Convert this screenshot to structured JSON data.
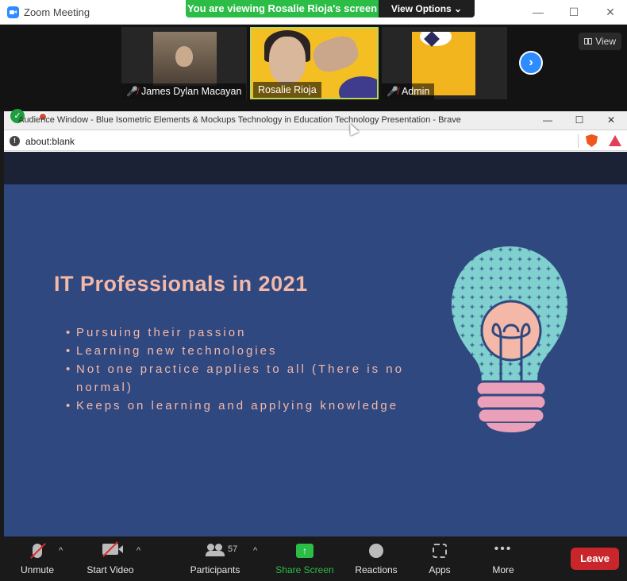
{
  "zoom": {
    "window_title": "Zoom Meeting",
    "share_banner": "You are viewing Rosalie Rioja's screen",
    "view_options": "View Options ⌄",
    "view_button": "View"
  },
  "participants_strip": [
    {
      "name": "James Dylan Macayan",
      "muted": true
    },
    {
      "name": "Rosalie Rioja",
      "muted": false
    },
    {
      "name": "Admin",
      "muted": true
    }
  ],
  "browser": {
    "title": "Audience Window - Blue Isometric Elements & Mockups Technology in Education Technology Presentation - Brave",
    "url": "about:blank"
  },
  "slide": {
    "title": "IT Professionals in 2021",
    "bullets": [
      "Pursuing their passion",
      "Learning new technologies",
      "Not one practice applies to all (There is no normal)",
      "Keeps on learning and applying knowledge"
    ]
  },
  "toolbar": {
    "unmute": "Unmute",
    "start_video": "Start Video",
    "participants": "Participants",
    "participants_count": "57",
    "share_screen": "Share Screen",
    "reactions": "Reactions",
    "apps": "Apps",
    "more": "More",
    "leave": "Leave"
  },
  "colors": {
    "share_green": "#2bbd46",
    "slide_bg": "#2f4880",
    "slide_text": "#f3b8a8",
    "bulb_glass": "#7fd0cf",
    "bulb_base": "#eaa0b8",
    "leave_red": "#c8262b",
    "zoom_blue": "#2d8cff"
  }
}
